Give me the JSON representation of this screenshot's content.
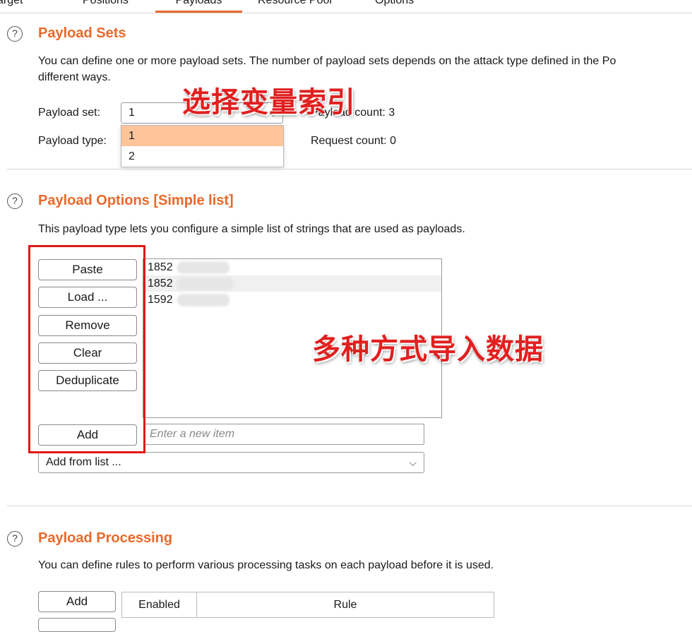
{
  "tabs": [
    {
      "label": "Target"
    },
    {
      "label": "Positions"
    },
    {
      "label": "Payloads",
      "active": true
    },
    {
      "label": "Resource Pool"
    },
    {
      "label": "Options"
    }
  ],
  "colors": {
    "accent": "#e8692a",
    "annotation": "#e02020",
    "selected_item": "#ffc59a"
  },
  "icons": {
    "help": "help-circle-icon",
    "chevron": "chevron-down-icon"
  },
  "payload_sets": {
    "help_glyph": "?",
    "title": "Payload Sets",
    "desc_line1": "You can define one or more payload sets. The number of payload sets depends on the attack type defined in the Po",
    "desc_line2": "different ways.",
    "set_label": "Payload set:",
    "set_value": "1",
    "set_options": [
      "1",
      "2"
    ],
    "type_label": "Payload type:",
    "count_label": "Payload count: 3",
    "request_label": "Request count: 0",
    "annotation": "选择变量索引"
  },
  "payload_options": {
    "help_glyph": "?",
    "title": "Payload Options [Simple list]",
    "desc": "This payload type lets you configure a simple list of strings that are used as payloads.",
    "buttons": {
      "paste": "Paste",
      "load": "Load ...",
      "remove": "Remove",
      "clear": "Clear",
      "deduplicate": "Deduplicate",
      "add": "Add"
    },
    "items": [
      "1852",
      "1852",
      "1592"
    ],
    "new_item_placeholder": "Enter a new item",
    "add_from_list": "Add from list ...",
    "annotation": "多种方式导入数据"
  },
  "payload_processing": {
    "help_glyph": "?",
    "title": "Payload Processing",
    "desc": "You can define rules to perform various processing tasks on each payload before it is used.",
    "add_button": "Add",
    "columns": [
      "Enabled",
      "Rule"
    ]
  }
}
